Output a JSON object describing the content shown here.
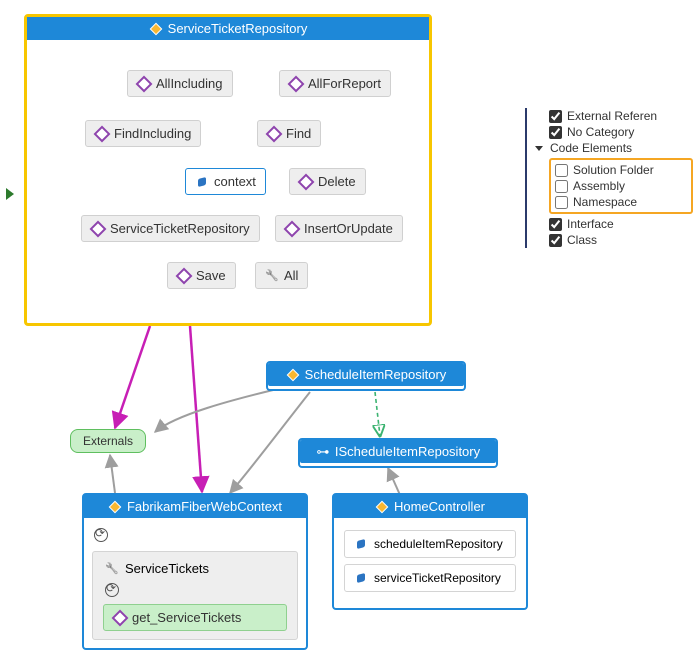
{
  "containers": {
    "serviceTicketRepo": {
      "title": "ServiceTicketRepository",
      "nodes": {
        "allIncluding": "AllIncluding",
        "allForReport": "AllForReport",
        "findIncluding": "FindIncluding",
        "find": "Find",
        "context": "context",
        "delete": "Delete",
        "serviceTicketRepository": "ServiceTicketRepository",
        "insertOrUpdate": "InsertOrUpdate",
        "save": "Save",
        "all": "All"
      }
    },
    "scheduleItemRepo": {
      "title": "ScheduleItemRepository"
    },
    "iScheduleItemRepo": {
      "title": "IScheduleItemRepository"
    },
    "fabrikam": {
      "title": "FabrikamFiberWebContext",
      "serviceTickets": "ServiceTickets",
      "getServiceTickets": "get_ServiceTickets"
    },
    "homeController": {
      "title": "HomeController",
      "scheduleItemRepo": "scheduleItemRepository",
      "serviceTicketRepo": "serviceTicketRepository"
    }
  },
  "externals": "Externals",
  "filters": {
    "externalReferen": "External Referen",
    "noCategory": "No Category",
    "codeElements": "Code Elements",
    "solutionFolder": "Solution Folder",
    "assembly": "Assembly",
    "namespace": "Namespace",
    "interface": "Interface",
    "class": "Class"
  },
  "chart_data": {
    "type": "graph",
    "description": "Visual Studio Code Map dependency diagram",
    "nodes": [
      {
        "id": "ServiceTicketRepository",
        "kind": "class-container",
        "selected": true,
        "members": [
          "AllIncluding",
          "AllForReport",
          "FindIncluding",
          "Find",
          "context",
          "Delete",
          "ServiceTicketRepository",
          "InsertOrUpdate",
          "Save",
          "All"
        ]
      },
      {
        "id": "ScheduleItemRepository",
        "kind": "class-container"
      },
      {
        "id": "IScheduleItemRepository",
        "kind": "interface"
      },
      {
        "id": "FabrikamFiberWebContext",
        "kind": "class-container",
        "members": [
          "ServiceTickets",
          "get_ServiceTickets"
        ]
      },
      {
        "id": "HomeController",
        "kind": "class-container",
        "members": [
          "scheduleItemRepository",
          "serviceTicketRepository"
        ]
      },
      {
        "id": "Externals",
        "kind": "external-group"
      }
    ],
    "edges": [
      {
        "from": "AllIncluding",
        "to": "context",
        "style": "dashed",
        "color": "#35a6e6"
      },
      {
        "from": "AllForReport",
        "to": "context",
        "style": "dashed",
        "color": "#35a6e6"
      },
      {
        "from": "FindIncluding",
        "to": "context",
        "style": "dashed",
        "color": "#35a6e6"
      },
      {
        "from": "Find",
        "to": "context",
        "style": "dashed",
        "color": "#35a6e6"
      },
      {
        "from": "Delete",
        "to": "context",
        "style": "dashed",
        "color": "#35a6e6"
      },
      {
        "from": "InsertOrUpdate",
        "to": "context",
        "style": "dashed",
        "color": "#35a6e6"
      },
      {
        "from": "Save",
        "to": "context",
        "style": "dashed",
        "color": "#35a6e6"
      },
      {
        "from": "All",
        "to": "context",
        "style": "dashed",
        "color": "#35a6e6"
      },
      {
        "from": "ServiceTicketRepository.ServiceTicketRepository",
        "to": "context",
        "style": "solid",
        "color": "#35a6e6"
      },
      {
        "from": "ServiceTicketRepository",
        "to": "Externals",
        "style": "solid",
        "color": "#c71fb5"
      },
      {
        "from": "ServiceTicketRepository",
        "to": "FabrikamFiberWebContext",
        "style": "solid",
        "color": "#c71fb5"
      },
      {
        "from": "ScheduleItemRepository",
        "to": "Externals",
        "style": "solid",
        "color": "#9e9e9e"
      },
      {
        "from": "ScheduleItemRepository",
        "to": "IScheduleItemRepository",
        "style": "dashed",
        "color": "#3cb371",
        "kind": "implements"
      },
      {
        "from": "ScheduleItemRepository",
        "to": "FabrikamFiberWebContext",
        "style": "solid",
        "color": "#9e9e9e"
      },
      {
        "from": "HomeController",
        "to": "IScheduleItemRepository",
        "style": "solid",
        "color": "#9e9e9e"
      },
      {
        "from": "FabrikamFiberWebContext",
        "to": "Externals",
        "style": "solid",
        "color": "#9e9e9e"
      }
    ],
    "filter_panel": {
      "checked": [
        "External Referen",
        "No Category",
        "Interface",
        "Class"
      ],
      "unchecked": [
        "Solution Folder",
        "Assembly",
        "Namespace"
      ],
      "highlighted_group": [
        "Solution Folder",
        "Assembly",
        "Namespace"
      ]
    }
  }
}
